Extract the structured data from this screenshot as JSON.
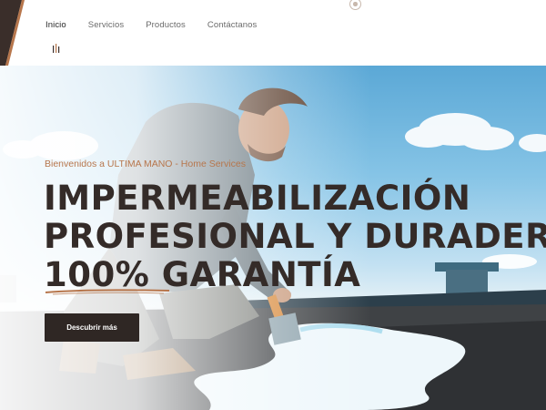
{
  "nav": {
    "items": [
      "Inicio",
      "Servicios",
      "Productos",
      "Contáctanos"
    ],
    "active": "Inicio"
  },
  "hero": {
    "welcome": "Bienvenidos a ULTIMA MANO - Home Services",
    "headline_lines": [
      "IMPERMEABILIZACIÓN",
      "PROFESIONAL Y DURADERA",
      "100% GARANTÍA"
    ],
    "cta_label": "Descubrir más"
  },
  "colors": {
    "brand_dark": "#342b28",
    "accent": "#b7764c",
    "button_bg": "#2f2724"
  },
  "icons": [
    "menu-bars-icon",
    "scroll-indicator-icon"
  ]
}
